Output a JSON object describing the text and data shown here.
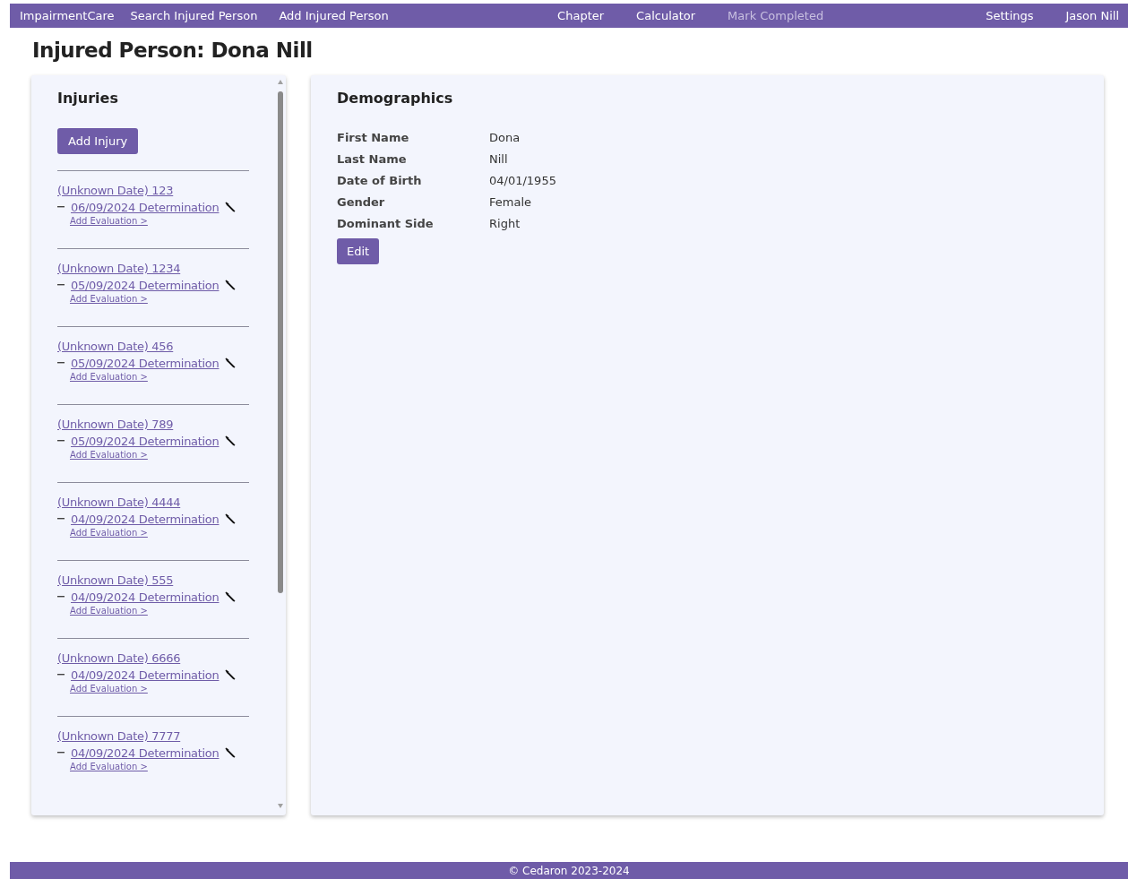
{
  "nav": {
    "brand": "ImpairmentCare",
    "left": [
      {
        "label": "Search Injured Person",
        "disabled": false
      },
      {
        "label": "Add Injured Person",
        "disabled": false
      }
    ],
    "center": [
      {
        "label": "Chapter",
        "disabled": false
      },
      {
        "label": "Calculator",
        "disabled": false
      },
      {
        "label": "Mark Completed",
        "disabled": true
      }
    ],
    "right": [
      {
        "label": "Settings",
        "disabled": false
      },
      {
        "label": "Jason Nill",
        "disabled": false
      }
    ]
  },
  "page_title": "Injured Person: Dona Nill",
  "injuries": {
    "title": "Injuries",
    "add_button": "Add Injury",
    "items": [
      {
        "title": "(Unknown Date) 123",
        "determination": "06/09/2024 Determination",
        "add_evaluation": "Add Evaluation >"
      },
      {
        "title": "(Unknown Date) 1234",
        "determination": "05/09/2024 Determination",
        "add_evaluation": "Add Evaluation >"
      },
      {
        "title": "(Unknown Date) 456",
        "determination": "05/09/2024 Determination",
        "add_evaluation": "Add Evaluation >"
      },
      {
        "title": "(Unknown Date) 789",
        "determination": "05/09/2024 Determination",
        "add_evaluation": "Add Evaluation >"
      },
      {
        "title": "(Unknown Date) 4444",
        "determination": "04/09/2024 Determination",
        "add_evaluation": "Add Evaluation >"
      },
      {
        "title": "(Unknown Date) 555",
        "determination": "04/09/2024 Determination",
        "add_evaluation": "Add Evaluation >"
      },
      {
        "title": "(Unknown Date) 6666",
        "determination": "04/09/2024 Determination",
        "add_evaluation": "Add Evaluation >"
      },
      {
        "title": "(Unknown Date) 7777",
        "determination": "04/09/2024 Determination",
        "add_evaluation": "Add Evaluation >"
      }
    ]
  },
  "demographics": {
    "title": "Demographics",
    "fields": [
      {
        "label": "First Name",
        "value": "Dona"
      },
      {
        "label": "Last Name",
        "value": "Nill"
      },
      {
        "label": "Date of Birth",
        "value": "04/01/1955"
      },
      {
        "label": "Gender",
        "value": "Female"
      },
      {
        "label": "Dominant Side",
        "value": "Right"
      }
    ],
    "edit_button": "Edit"
  },
  "footer": "© Cedaron 2023-2024"
}
